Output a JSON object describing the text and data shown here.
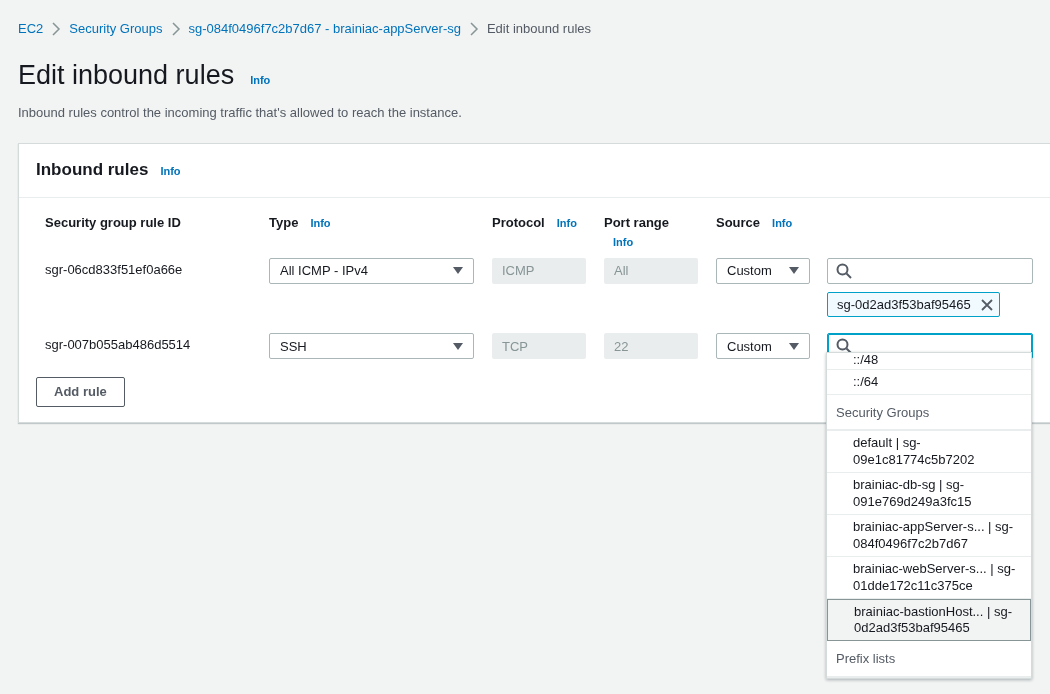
{
  "breadcrumbs": [
    {
      "label": "EC2",
      "current": false
    },
    {
      "label": "Security Groups",
      "current": false
    },
    {
      "label": "sg-084f0496f7c2b7d67 - brainiac-appServer-sg",
      "current": false
    },
    {
      "label": "Edit inbound rules",
      "current": true
    }
  ],
  "page": {
    "title": "Edit inbound rules",
    "info": "Info",
    "description": "Inbound rules control the incoming traffic that's allowed to reach the instance."
  },
  "panel": {
    "title": "Inbound rules",
    "info": "Info",
    "columns": [
      {
        "label": "Security group rule ID"
      },
      {
        "label": "Type",
        "info": "Info"
      },
      {
        "label": "Protocol",
        "info": "Info"
      },
      {
        "label": "Port range",
        "info": "Info"
      },
      {
        "label": "Source",
        "info": "Info"
      }
    ],
    "rules": [
      {
        "id": "sgr-06cd833f51ef0a66e",
        "type": "All ICMP - IPv4",
        "protocol": "ICMP",
        "port_range": "All",
        "source": "Custom",
        "focused": false,
        "tokens": [
          "sg-0d2ad3f53baf95465"
        ]
      },
      {
        "id": "sgr-007b055ab486d5514",
        "type": "SSH",
        "protocol": "TCP",
        "port_range": "22",
        "source": "Custom",
        "focused": true
      }
    ],
    "add_button": "Add rule"
  },
  "dropdown": {
    "items": [
      {
        "kind": "option",
        "label": "::/48",
        "selected": false
      },
      {
        "kind": "option",
        "label": "::/64",
        "selected": false
      },
      {
        "kind": "group",
        "label": "Security Groups"
      },
      {
        "kind": "option",
        "label": "default | sg-09e1c81774c5b7202",
        "selected": false
      },
      {
        "kind": "option",
        "label": "brainiac-db-sg | sg-091e769d249a3fc15",
        "selected": false
      },
      {
        "kind": "option",
        "label": "brainiac-appServer-s... | sg-084f0496f7c2b7d67",
        "selected": false
      },
      {
        "kind": "option",
        "label": "brainiac-webServer-s... | sg-01dde172c11c375ce",
        "selected": false
      },
      {
        "kind": "option",
        "label": "brainiac-bastionHost... | sg-0d2ad3f53baf95465",
        "selected": true
      },
      {
        "kind": "group",
        "label": "Prefix lists"
      }
    ]
  }
}
